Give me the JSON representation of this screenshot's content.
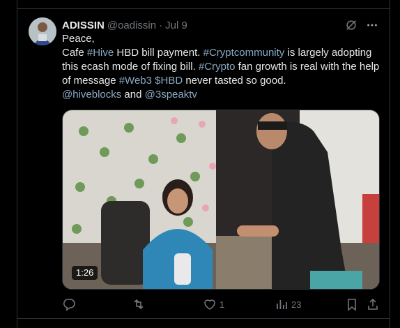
{
  "tweet": {
    "display_name": "ADISSIN",
    "handle": "@oadissin",
    "separator": "·",
    "date": "Jul 9",
    "lines": {
      "l1": "Peace,",
      "l2_a": "Cafe ",
      "l2_tag1": "#Hive",
      "l2_b": " HBD bill payment. ",
      "l2_tag2": "#Cryptcommunity",
      "l2_c": " is largely adopting this ecash mode of fixing bill. ",
      "l2_tag3": "#Crypto",
      "l2_d": " fan growth is real with the help of message  ",
      "l2_tag4": "#Web3",
      "l2_e": " ",
      "l2_tag5": "$HBD",
      "l2_f": " never tasted so good.",
      "l3_tag1": "@hiveblocks",
      "l3_b": " and ",
      "l3_tag2": "@3speaktv"
    },
    "media": {
      "duration": "1:26"
    },
    "metrics": {
      "likes": "1",
      "views": "23"
    }
  },
  "colors": {
    "background": "#000000",
    "text": "#e7e9ea",
    "muted": "#71767b",
    "link": "#8aa9c2",
    "border": "#2f3336"
  },
  "icons": [
    "grok-icon",
    "more-icon",
    "reply-icon",
    "retweet-icon",
    "like-icon",
    "views-icon",
    "bookmark-icon",
    "share-icon"
  ]
}
